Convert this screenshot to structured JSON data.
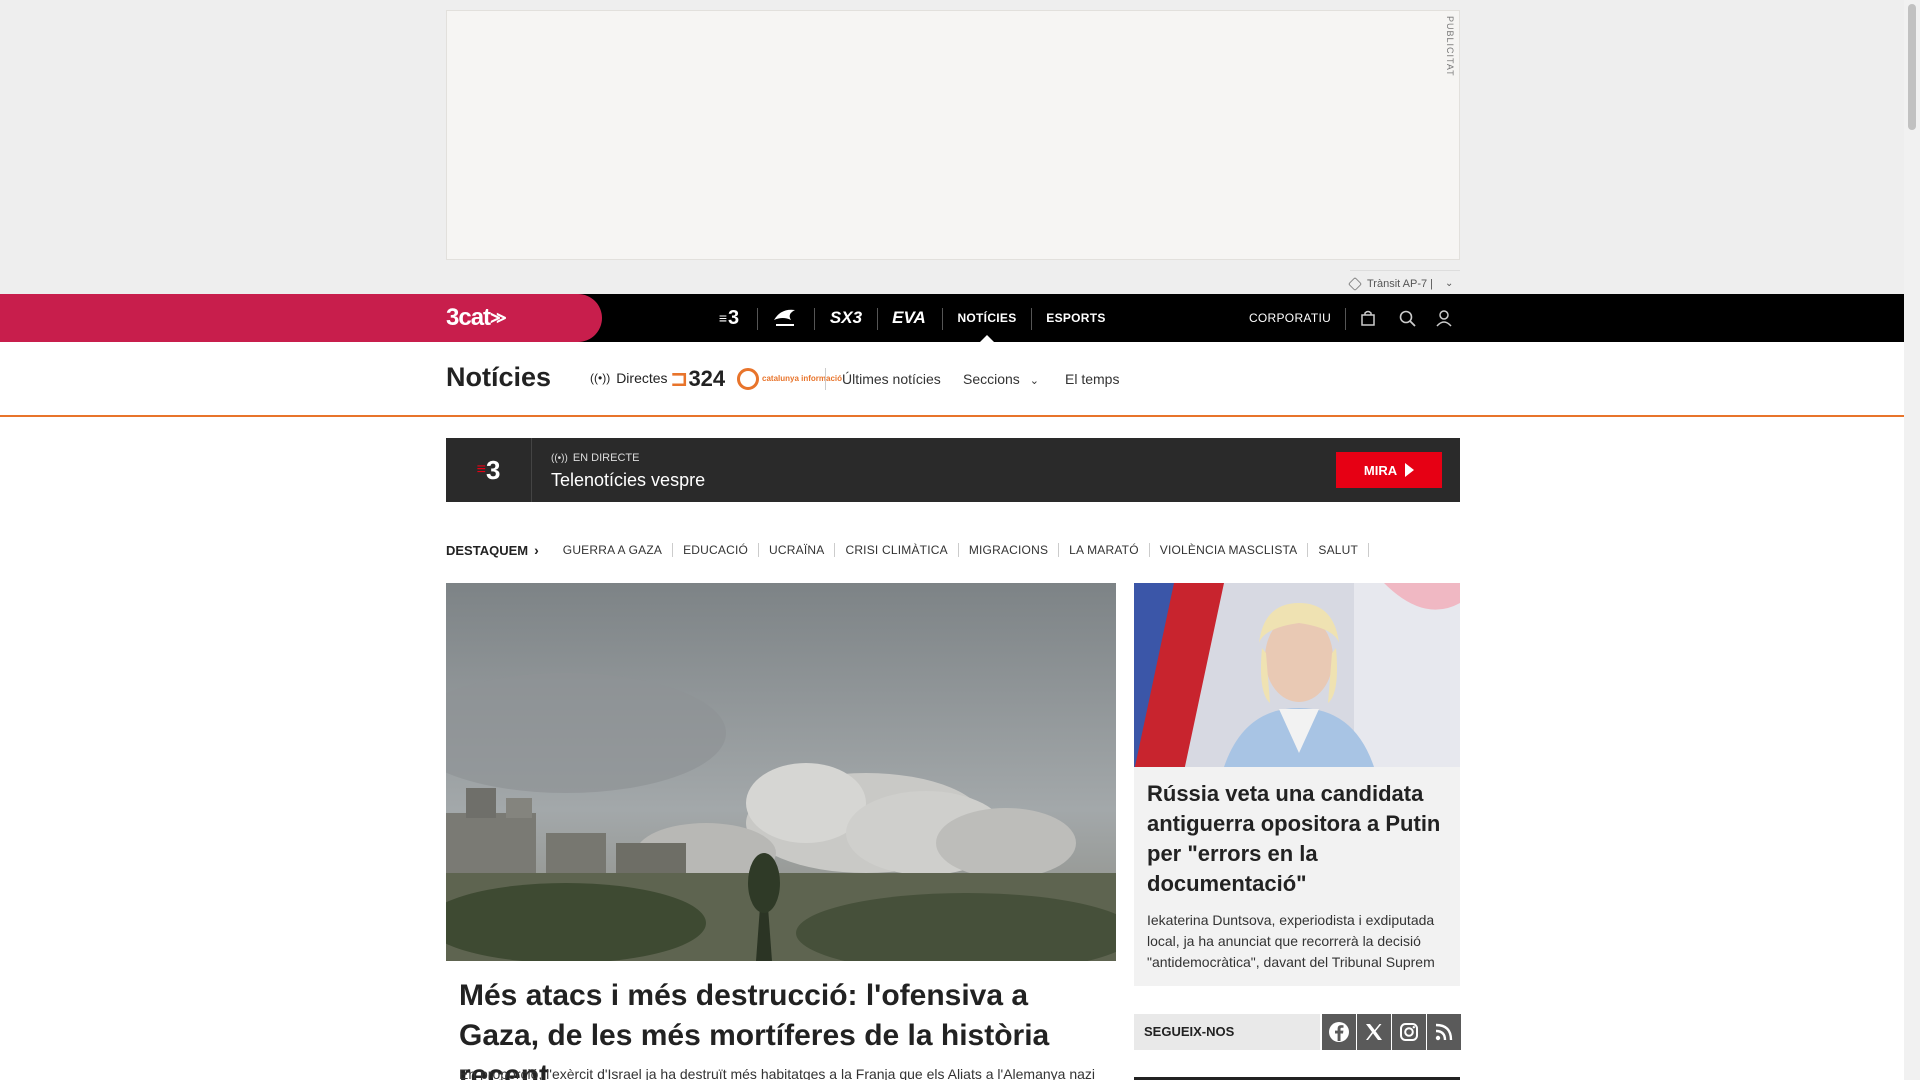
{
  "ad": {
    "label": "PUBLICITAT"
  },
  "traffic": {
    "label": "Trànsit AP-7 |"
  },
  "topbar": {
    "brand": "3cat",
    "channels": [
      "3",
      "Cat Ràdio",
      "SX3",
      "EVA"
    ],
    "nav": {
      "noticies": "NOTÍCIES",
      "esports": "ESPORTS",
      "corporatiu": "CORPORATIU"
    }
  },
  "section": {
    "title": "Notícies",
    "directes": "Directes",
    "logo_324": "324",
    "logo_ci": "catalunya informació",
    "links": {
      "ultimes": "Últimes notícies",
      "seccions": "Seccions",
      "temps": "El temps"
    }
  },
  "live": {
    "channel": "3",
    "status": "EN DIRECTE",
    "title": "Telenotícies vespre",
    "button": "MIRA"
  },
  "highlights": {
    "lead": "DESTAQUEM",
    "items": [
      "GUERRA A GAZA",
      "EDUCACIÓ",
      "UCRAÏNA",
      "CRISI CLIMÀTICA",
      "MIGRACIONS",
      "LA MARATÓ",
      "VIOLÈNCIA MASCLISTA",
      "SALUT"
    ]
  },
  "main_article": {
    "title": "Més atacs i més destrucció: l'ofensiva a Gaza, de les més mortíferes de la història recent",
    "subtitle": "En proporció, l'exèrcit d'Israel ja ha destruït més habitatges a la Franja que els Aliats a l'Alemanya nazi"
  },
  "side_article": {
    "title": "Rússia veta una candidata antiguerra opositora a Putin per \"errors en la documentació\"",
    "subtitle": "Iekaterina Duntsova, experiodista i exdiputada local, ja ha anunciat que recorrerà la decisió \"antidemocràtica\", davant del Tribunal Suprem"
  },
  "follow": {
    "label": "SEGUEIX-NOS",
    "networks": [
      "facebook-icon",
      "x-icon",
      "instagram-icon",
      "rss-icon"
    ]
  }
}
